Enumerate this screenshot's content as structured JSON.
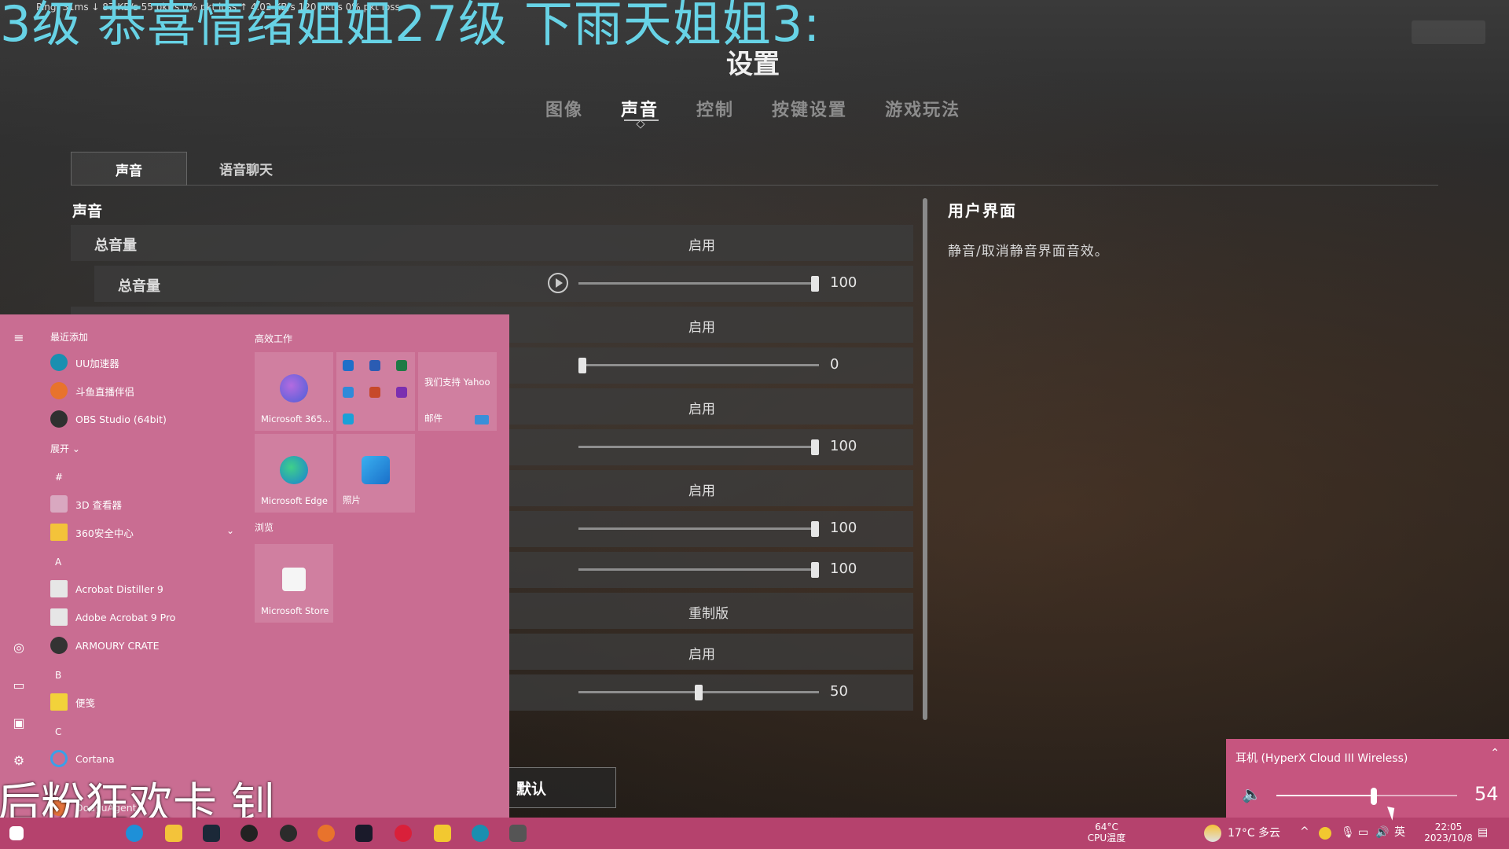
{
  "overlay": {
    "stats": "Ping: 31ms   ↓ 87 KB/s  55 pkt/s  0% pkt loss   ↑ 4.02 KB/s  120 pkt/s  0% pkt loss",
    "danmaku_top": "3级  恭喜情绪姐姐27级  下雨天姐姐3:",
    "danmaku_bottom": "后粉狂欢卡  钊"
  },
  "settings": {
    "title": "设置",
    "main_tabs": [
      {
        "label": "图像",
        "active": false
      },
      {
        "label": "声音",
        "active": true
      },
      {
        "label": "控制",
        "active": false
      },
      {
        "label": "按键设置",
        "active": false
      },
      {
        "label": "游戏玩法",
        "active": false
      }
    ],
    "sub_tabs": [
      {
        "label": "声音",
        "active": true
      },
      {
        "label": "语音聊天",
        "active": false
      }
    ],
    "section_heading": "声音",
    "rows": [
      {
        "label": "总音量",
        "value": "启用"
      },
      {
        "label": "总音量",
        "slider": 100,
        "num": "100",
        "has_play": true
      },
      {
        "label": "",
        "value": "启用"
      },
      {
        "label": "",
        "slider": 0,
        "num": "0"
      },
      {
        "label": "",
        "value": "启用"
      },
      {
        "label": "",
        "slider": 100,
        "num": "100"
      },
      {
        "label": "",
        "value": "启用"
      },
      {
        "label": "",
        "slider": 100,
        "num": "100"
      },
      {
        "label": "",
        "slider": 100,
        "num": "100"
      },
      {
        "label": "",
        "value": "重制版"
      },
      {
        "label": "",
        "value": "启用"
      },
      {
        "label": "",
        "slider": 50,
        "num": "50"
      }
    ],
    "ui_heading": "用户界面",
    "ui_desc": "静音/取消静音界面音效。",
    "default_button": "默认"
  },
  "start_menu": {
    "recent_header": "最近添加",
    "recent_apps": [
      {
        "name": "UU加速器",
        "color": "#1a8fb0"
      },
      {
        "name": "斗鱼直播伴侣",
        "color": "#e8732c"
      },
      {
        "name": "OBS Studio (64bit)",
        "color": "#303030"
      }
    ],
    "expand": "展开",
    "groups": [
      {
        "letter": "#",
        "apps": [
          {
            "name": "3D 查看器",
            "color": "#d9a8c0"
          },
          {
            "name": "360安全中心",
            "color": "#f3c33a",
            "folder": true
          }
        ]
      },
      {
        "letter": "A",
        "apps": [
          {
            "name": "Acrobat Distiller 9",
            "color": "#e6e6e6"
          },
          {
            "name": "Adobe Acrobat 9 Pro",
            "color": "#e6e6e6"
          },
          {
            "name": "ARMOURY CRATE",
            "color": "#333333"
          }
        ]
      },
      {
        "letter": "B",
        "apps": [
          {
            "name": "便笺",
            "color": "#f2d23a"
          }
        ]
      },
      {
        "letter": "C",
        "apps": [
          {
            "name": "Cortana",
            "color": "#3aa0e8"
          }
        ]
      }
    ],
    "partial_app": "DouyuAgent",
    "tiles_header_1": "高效工作",
    "tiles_header_2": "浏览",
    "tiles": {
      "m365": "Microsoft 365...",
      "yahoo": "我们支持 Yahoo",
      "mail": "邮件",
      "edge": "Microsoft Edge",
      "photos": "照片",
      "store": "Microsoft Store"
    }
  },
  "volume_flyout": {
    "device": "耳机 (HyperX Cloud III Wireless)",
    "level": 54,
    "level_text": "54"
  },
  "taskbar": {
    "cpu_temp": "64°C",
    "cpu_label": "CPU温度",
    "weather": "17°C  多云",
    "ime": "英",
    "time": "22:05",
    "date": "2023/10/8"
  }
}
